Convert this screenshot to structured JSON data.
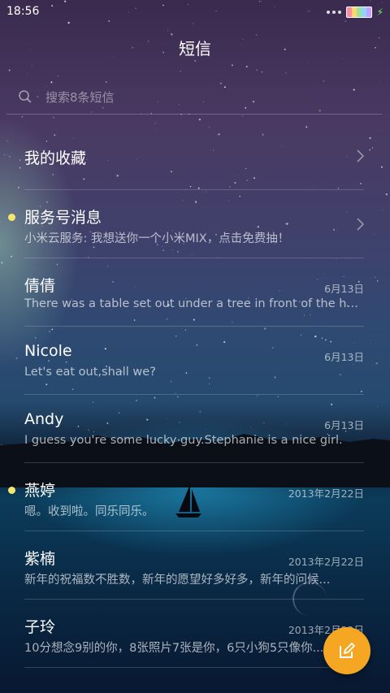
{
  "status_bar": {
    "time": "18:56"
  },
  "header": {
    "title": "短信"
  },
  "search": {
    "placeholder": "搜索8条短信"
  },
  "conversations": [
    {
      "name": "我的收藏",
      "preview": "",
      "date": "",
      "unread": false,
      "chevron": true
    },
    {
      "name": "服务号消息",
      "preview": "小米云服务: 我想送你一个小米MIX，点击免费抽！",
      "date": "",
      "unread": true,
      "chevron": true
    },
    {
      "name": "倩倩",
      "preview": "There was a table set out under a tree in front of the house...",
      "date": "6月13日",
      "unread": false
    },
    {
      "name": "Nicole",
      "preview": "Let's eat out,shall we?",
      "date": "6月13日",
      "unread": false
    },
    {
      "name": "Andy",
      "preview": "I guess you're some lucky guy.Stephanie is a nice girl.",
      "date": "6月13日",
      "unread": false
    },
    {
      "name": "燕婷",
      "preview": "嗯。收到啦。同乐同乐。",
      "date": "2013年2月22日",
      "unread": true
    },
    {
      "name": "紫楠",
      "preview": "新年的祝福数不胜数，新年的愿望好多好多，新年的问候...",
      "date": "2013年2月22日",
      "unread": false
    },
    {
      "name": "子玲",
      "preview": "10分想念9别的你，8张照片7张是你，6只小狗5只像你...",
      "date": "2013年2月22日",
      "unread": false
    }
  ],
  "colors": {
    "fab": "#f5a623",
    "unread_dot": "#f5e66e"
  }
}
